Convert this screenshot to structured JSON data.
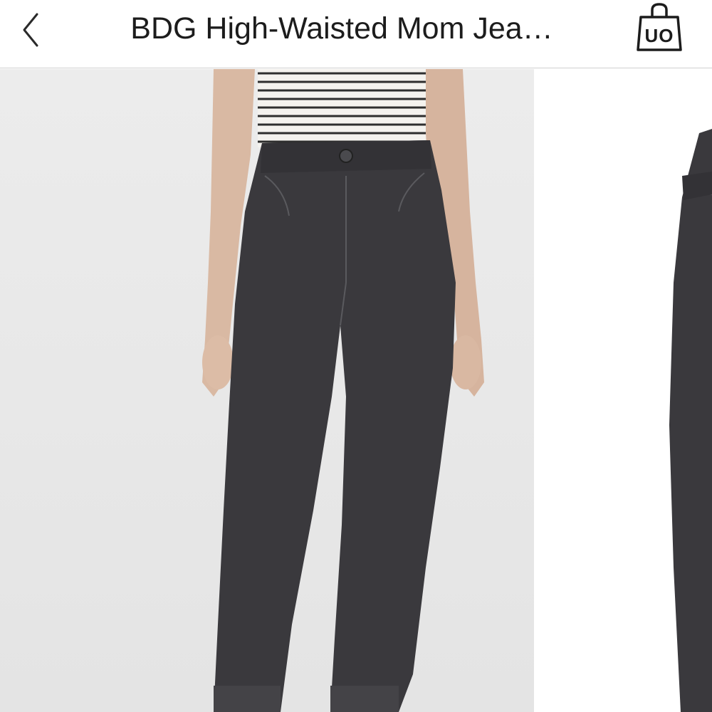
{
  "header": {
    "title": "BDG High-Waisted Mom Jea…",
    "back_icon": "chevron-left-icon",
    "bag_icon": "shopping-bag-icon",
    "bag_label": "UO"
  },
  "gallery": {
    "images": [
      {
        "name": "product-photo-front",
        "subject": "model wearing washed black high-waisted mom jeans with striped top"
      },
      {
        "name": "product-photo-side",
        "subject": "side view of washed black mom jeans"
      }
    ]
  },
  "colors": {
    "denim": "#3a393d",
    "background": "#e9e9e9",
    "text": "#1c1c1c"
  }
}
